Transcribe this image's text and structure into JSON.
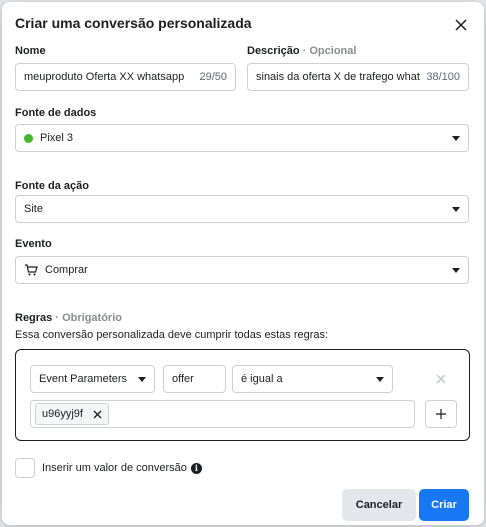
{
  "dialog": {
    "title": "Criar uma conversão personalizada"
  },
  "name_field": {
    "label": "Nome",
    "value": "meuproduto Oferta XX whatsapp",
    "count": "29/50"
  },
  "description_field": {
    "label": "Descrição",
    "optional": "· Opcional",
    "value": "sinais da oferta X de trafego whatsapp",
    "count": "38/100"
  },
  "data_source": {
    "label": "Fonte de dados",
    "value": "Pixel 3",
    "status_color": "#42b72a"
  },
  "action_source": {
    "label": "Fonte da ação",
    "value": "Site"
  },
  "event": {
    "label": "Evento",
    "value": "Comprar",
    "icon": "shopping-cart-icon"
  },
  "rules": {
    "label": "Regras",
    "required": "· Obrigatório",
    "description": "Essa conversão personalizada deve cumprir todas estas regras:",
    "rule": {
      "parameter": "Event Parameters",
      "key": "offer",
      "operator": "é igual a",
      "values": [
        "u96yyj9f"
      ]
    }
  },
  "conversion_value": {
    "label": "Inserir um valor de conversão"
  },
  "footer": {
    "cancel_label": "Cancelar",
    "create_label": "Criar"
  },
  "colors": {
    "primary": "#1877f2",
    "status_active": "#42b72a"
  }
}
